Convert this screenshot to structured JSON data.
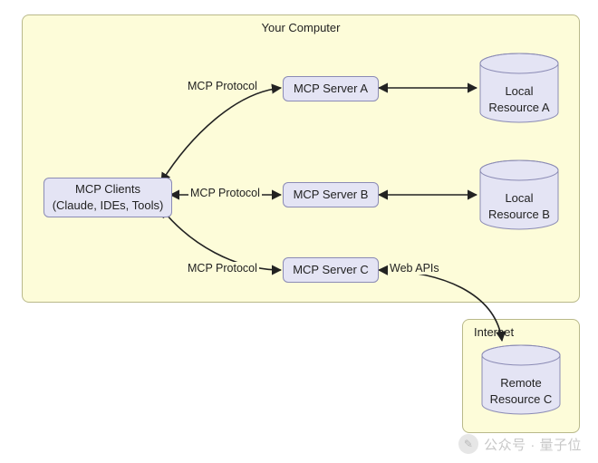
{
  "regions": {
    "computer": {
      "title": "Your Computer"
    },
    "internet": {
      "title": "Internet"
    }
  },
  "nodes": {
    "clients": {
      "line1": "MCP Clients",
      "line2": "(Claude, IDEs, Tools)"
    },
    "server_a": "MCP Server A",
    "server_b": "MCP Server B",
    "server_c": "MCP Server C",
    "resource_a": {
      "line1": "Local",
      "line2": "Resource A"
    },
    "resource_b": {
      "line1": "Local",
      "line2": "Resource B"
    },
    "resource_c": {
      "line1": "Remote",
      "line2": "Resource C"
    }
  },
  "edges": {
    "protocol_a": "MCP Protocol",
    "protocol_b": "MCP Protocol",
    "protocol_c": "MCP Protocol",
    "web_apis": "Web APIs"
  },
  "watermark": {
    "text": "公众号 · 量子位",
    "icon": "✎"
  },
  "chart_data": {
    "type": "diagram",
    "title": "MCP architecture overview",
    "regions": [
      {
        "id": "computer",
        "label": "Your Computer"
      },
      {
        "id": "internet",
        "label": "Internet"
      }
    ],
    "nodes": [
      {
        "id": "clients",
        "label": "MCP Clients (Claude, IDEs, Tools)",
        "shape": "rect",
        "region": "computer"
      },
      {
        "id": "server_a",
        "label": "MCP Server A",
        "shape": "rect",
        "region": "computer"
      },
      {
        "id": "server_b",
        "label": "MCP Server B",
        "shape": "rect",
        "region": "computer"
      },
      {
        "id": "server_c",
        "label": "MCP Server C",
        "shape": "rect",
        "region": "computer"
      },
      {
        "id": "resource_a",
        "label": "Local Resource A",
        "shape": "cylinder",
        "region": "computer"
      },
      {
        "id": "resource_b",
        "label": "Local Resource B",
        "shape": "cylinder",
        "region": "computer"
      },
      {
        "id": "resource_c",
        "label": "Remote Resource C",
        "shape": "cylinder",
        "region": "internet"
      }
    ],
    "edges": [
      {
        "from": "clients",
        "to": "server_a",
        "label": "MCP Protocol",
        "bidirectional": true
      },
      {
        "from": "clients",
        "to": "server_b",
        "label": "MCP Protocol",
        "bidirectional": true
      },
      {
        "from": "clients",
        "to": "server_c",
        "label": "MCP Protocol",
        "bidirectional": true
      },
      {
        "from": "server_a",
        "to": "resource_a",
        "label": "",
        "bidirectional": true
      },
      {
        "from": "server_b",
        "to": "resource_b",
        "label": "",
        "bidirectional": true
      },
      {
        "from": "server_c",
        "to": "resource_c",
        "label": "Web APIs",
        "bidirectional": true
      }
    ]
  }
}
